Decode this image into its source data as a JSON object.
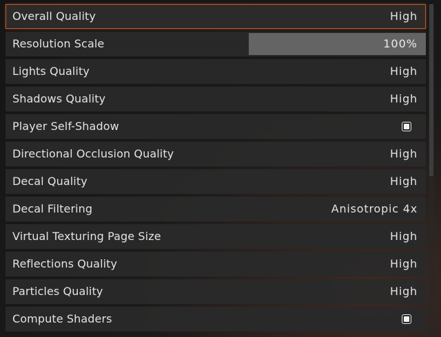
{
  "settings": [
    {
      "label": "Overall Quality",
      "type": "select",
      "value": "High",
      "selected": true
    },
    {
      "label": "Resolution Scale",
      "type": "slider",
      "value": "100%",
      "level": 1.0
    },
    {
      "label": "Lights Quality",
      "type": "select",
      "value": "High"
    },
    {
      "label": "Shadows Quality",
      "type": "select",
      "value": "High"
    },
    {
      "label": "Player Self-Shadow",
      "type": "checkbox",
      "checked": true
    },
    {
      "label": "Directional Occlusion Quality",
      "type": "select",
      "value": "High"
    },
    {
      "label": "Decal Quality",
      "type": "select",
      "value": "High"
    },
    {
      "label": "Decal Filtering",
      "type": "select",
      "value": "Anisotropic 4x"
    },
    {
      "label": "Virtual Texturing Page Size",
      "type": "select",
      "value": "High"
    },
    {
      "label": "Reflections Quality",
      "type": "select",
      "value": "High"
    },
    {
      "label": "Particles Quality",
      "type": "select",
      "value": "High"
    },
    {
      "label": "Compute Shaders",
      "type": "checkbox",
      "checked": true
    }
  ],
  "colors": {
    "accent_border": "#c4562a",
    "row_background": "#2a2a2a",
    "slider_track": "#5d5d5d",
    "text": "#e3e3e3"
  }
}
